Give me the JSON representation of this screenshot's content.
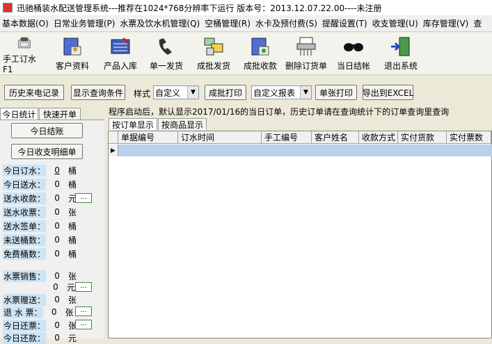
{
  "window": {
    "title": "迅驰桶装水配送管理系统---推荐在1024*768分辨率下运行  版本号：2013.12.07.22.00----未注册"
  },
  "menu": [
    "基本数据(O)",
    "日常业务管理(P)",
    "水票及饮水机管理(Q)",
    "空桶管理(R)",
    "水卡及预付费(S)",
    "提醒设置(T)",
    "收支管理(U)",
    "库存管理(V)",
    "查"
  ],
  "toolbar": [
    {
      "label": "手工订水F1",
      "icon": "phone-cart-icon"
    },
    {
      "label": "客户资料",
      "icon": "customer-book-icon"
    },
    {
      "label": "产品入库",
      "icon": "stock-in-icon"
    },
    {
      "label": "单一发货",
      "icon": "phone-handset-icon"
    },
    {
      "label": "成批发货",
      "icon": "batch-ship-icon"
    },
    {
      "label": "成批收款",
      "icon": "batch-collect-icon"
    },
    {
      "label": "删除订货单",
      "icon": "shredder-icon"
    },
    {
      "label": "当日结帐",
      "icon": "glasses-icon"
    },
    {
      "label": "退出系统",
      "icon": "exit-door-icon"
    }
  ],
  "options": {
    "history_calls": "历史来电记录",
    "show_query": "显示查询条件",
    "style_label": "样式",
    "style_value": "自定义",
    "batch_print": "成批打印",
    "report_value": "自定义报表",
    "single_print": "单张打印",
    "export_excel": "导出到EXCEL"
  },
  "left_tabs": [
    "今日统计",
    "快速开单"
  ],
  "left_buttons": {
    "settle_today": "今日结账",
    "today_detail": "今日收支明细单"
  },
  "stats": [
    {
      "label": "今日订水：",
      "value": "0",
      "unit": "桶"
    },
    {
      "label": "今日送水：",
      "value": "0",
      "unit": "桶"
    },
    {
      "label": "送水收款：",
      "value": "0",
      "unit": "元"
    },
    {
      "label": "送水收票：",
      "value": "0",
      "unit": "张"
    },
    {
      "label": "送水签单：",
      "value": "0",
      "unit": "桶"
    },
    {
      "label": "未送桶数：",
      "value": "0",
      "unit": "桶"
    },
    {
      "label": "免费桶数：",
      "value": "0",
      "unit": "桶"
    },
    {
      "label": "水票销售：",
      "value": "0",
      "unit": "张"
    },
    {
      "label": "",
      "value": "0",
      "unit": "元"
    },
    {
      "label": "水票赠送：",
      "value": "0",
      "unit": "张"
    },
    {
      "label": "退 水 票：",
      "value": "0",
      "unit": "张"
    },
    {
      "label": "今日还票：",
      "value": "0",
      "unit": "张"
    },
    {
      "label": "今日还款：",
      "value": "0",
      "unit": "元"
    }
  ],
  "dots_label": "...",
  "notice": "程序启动后，默认显示2017/01/16的当日订单，历史订单请在查询统计下的订单查询里查询",
  "grid_tabs": [
    "按订单显示",
    "按商品显示"
  ],
  "grid_columns": [
    "单据编号",
    "订水时间",
    "手工编号",
    "客户姓名",
    "收款方式",
    "实付货款",
    "实付票数"
  ],
  "colors": {
    "selected_row": "#b9d1ea",
    "stat_label_bg": "#cde4f5"
  }
}
